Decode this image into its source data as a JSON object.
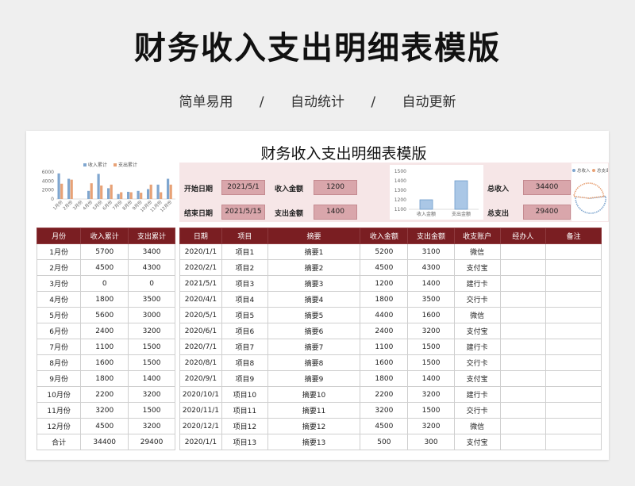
{
  "header": {
    "title": "财务收入支出明细表模版",
    "tags": [
      "简单易用",
      "自动统计",
      "自动更新"
    ],
    "separator": "/"
  },
  "sheet": {
    "title": "财务收入支出明细表模版",
    "info": {
      "start_label": "开始日期",
      "start_value": "2021/5/1",
      "end_label": "结束日期",
      "end_value": "2021/5/15",
      "income_label": "收入金额",
      "income_value": "1200",
      "expense_label": "支出金额",
      "expense_value": "1400",
      "total_income_label": "总收入",
      "total_income_value": "34400",
      "total_expense_label": "总支出",
      "total_expense_value": "29400"
    },
    "colors": {
      "header_bg": "#7a1e22",
      "income_series": "#7fa6cf",
      "expense_series": "#e8a276",
      "input_box": "#d9a6ab"
    }
  },
  "chart_data": [
    {
      "type": "bar",
      "categories": [
        "1月份",
        "2月份",
        "3月份",
        "4月份",
        "5月份",
        "6月份",
        "7月份",
        "8月份",
        "9月份",
        "10月份",
        "11月份",
        "12月份"
      ],
      "series": [
        {
          "name": "收入累计",
          "values": [
            5700,
            4500,
            0,
            1800,
            5600,
            2400,
            1100,
            1600,
            1800,
            2200,
            3200,
            4500
          ]
        },
        {
          "name": "支出累计",
          "values": [
            3400,
            4300,
            0,
            3500,
            3000,
            3200,
            1500,
            1500,
            1400,
            3200,
            1500,
            3200
          ]
        }
      ],
      "yticks": [
        "6000",
        "4000",
        "2000",
        "0"
      ],
      "ylim": [
        0,
        6000
      ],
      "legend": "top"
    },
    {
      "type": "bar",
      "categories": [
        "收入金额",
        "支出金额"
      ],
      "values": [
        1200,
        1400
      ],
      "yticks": [
        "1500",
        "1400",
        "1300",
        "1200",
        "1100"
      ],
      "ylim": [
        1100,
        1500
      ]
    },
    {
      "type": "pie",
      "labels": [
        "总收入",
        "总支出"
      ],
      "values": [
        34400,
        29400
      ],
      "legend": "top"
    }
  ],
  "monthly": {
    "headers": [
      "月份",
      "收入累计",
      "支出累计"
    ],
    "rows": [
      [
        "1月份",
        "5700",
        "3400"
      ],
      [
        "2月份",
        "4500",
        "4300"
      ],
      [
        "3月份",
        "0",
        "0"
      ],
      [
        "4月份",
        "1800",
        "3500"
      ],
      [
        "5月份",
        "5600",
        "3000"
      ],
      [
        "6月份",
        "2400",
        "3200"
      ],
      [
        "7月份",
        "1100",
        "1500"
      ],
      [
        "8月份",
        "1600",
        "1500"
      ],
      [
        "9月份",
        "1800",
        "1400"
      ],
      [
        "10月份",
        "2200",
        "3200"
      ],
      [
        "11月份",
        "3200",
        "1500"
      ],
      [
        "12月份",
        "4500",
        "3200"
      ],
      [
        "合计",
        "34400",
        "29400"
      ]
    ]
  },
  "detail": {
    "headers": [
      "日期",
      "项目",
      "摘要",
      "收入金额",
      "支出金额",
      "收支账户",
      "经办人",
      "备注"
    ],
    "rows": [
      [
        "2020/1/1",
        "项目1",
        "摘要1",
        "5200",
        "3100",
        "微信",
        "",
        ""
      ],
      [
        "2020/2/1",
        "项目2",
        "摘要2",
        "4500",
        "4300",
        "支付宝",
        "",
        ""
      ],
      [
        "2021/5/1",
        "项目3",
        "摘要3",
        "1200",
        "1400",
        "建行卡",
        "",
        ""
      ],
      [
        "2020/4/1",
        "项目4",
        "摘要4",
        "1800",
        "3500",
        "交行卡",
        "",
        ""
      ],
      [
        "2020/5/1",
        "项目5",
        "摘要5",
        "4400",
        "1600",
        "微信",
        "",
        ""
      ],
      [
        "2020/6/1",
        "项目6",
        "摘要6",
        "2400",
        "3200",
        "支付宝",
        "",
        ""
      ],
      [
        "2020/7/1",
        "项目7",
        "摘要7",
        "1100",
        "1500",
        "建行卡",
        "",
        ""
      ],
      [
        "2020/8/1",
        "项目8",
        "摘要8",
        "1600",
        "1500",
        "交行卡",
        "",
        ""
      ],
      [
        "2020/9/1",
        "项目9",
        "摘要9",
        "1800",
        "1400",
        "支付宝",
        "",
        ""
      ],
      [
        "2020/10/1",
        "项目10",
        "摘要10",
        "2200",
        "3200",
        "建行卡",
        "",
        ""
      ],
      [
        "2020/11/1",
        "项目11",
        "摘要11",
        "3200",
        "1500",
        "交行卡",
        "",
        ""
      ],
      [
        "2020/12/1",
        "项目12",
        "摘要12",
        "4500",
        "3200",
        "微信",
        "",
        ""
      ],
      [
        "2020/1/1",
        "项目13",
        "摘要13",
        "500",
        "300",
        "支付宝",
        "",
        ""
      ]
    ]
  }
}
